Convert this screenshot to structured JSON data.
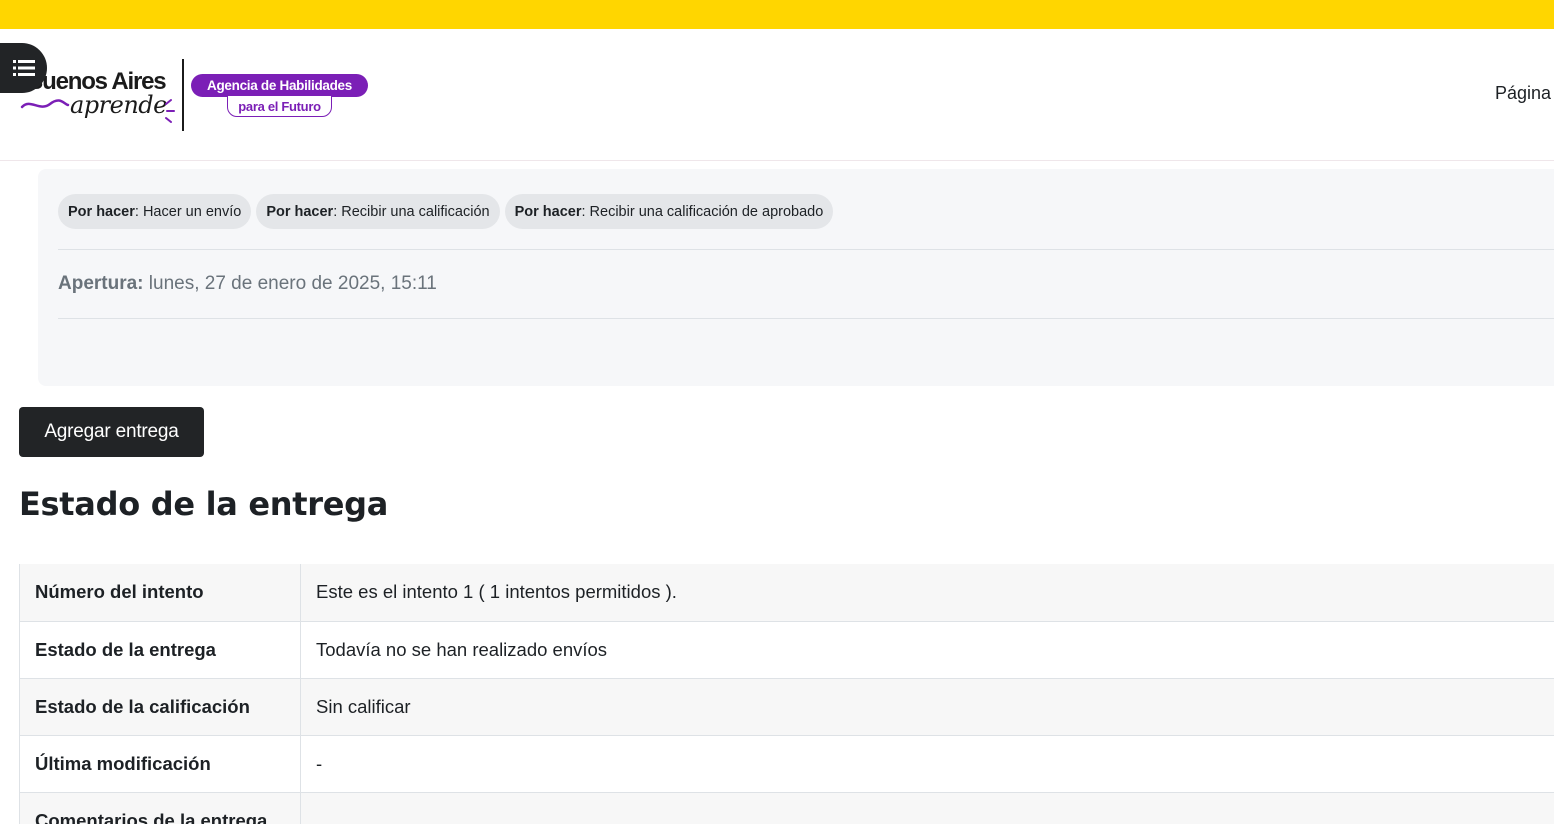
{
  "header": {
    "logo": {
      "word1": "Buenos Aires",
      "word2": "aprende",
      "agency": "Agencia de Habilidades",
      "future": "para el Futuro"
    },
    "nav_link": "Página"
  },
  "activity": {
    "completion": [
      {
        "prefix": "Por hacer",
        "text": ": Hacer un envío"
      },
      {
        "prefix": "Por hacer",
        "text": ": Recibir una calificación"
      },
      {
        "prefix": "Por hacer",
        "text": ": Recibir una calificación de aprobado"
      }
    ],
    "opening_label": "Apertura:",
    "opening_value": " lunes, 27 de enero de 2025, 15:11"
  },
  "actions": {
    "add_submission": "Agregar entrega"
  },
  "submission_status": {
    "title": "Estado de la entrega",
    "rows": [
      {
        "label": "Número del intento",
        "value": "Este es el intento 1 ( 1 intentos permitidos )."
      },
      {
        "label": "Estado de la entrega",
        "value": "Todavía no se han realizado envíos"
      },
      {
        "label": "Estado de la calificación",
        "value": "Sin calificar"
      },
      {
        "label": "Última modificación",
        "value": "-"
      },
      {
        "label": "Comentarios de la entrega",
        "value": ""
      }
    ]
  },
  "colors": {
    "topbar": "#ffd600",
    "brand_purple": "#7b1fb6",
    "dark_button": "#222426"
  },
  "icons": {
    "drawer_toggle": "list-icon"
  }
}
